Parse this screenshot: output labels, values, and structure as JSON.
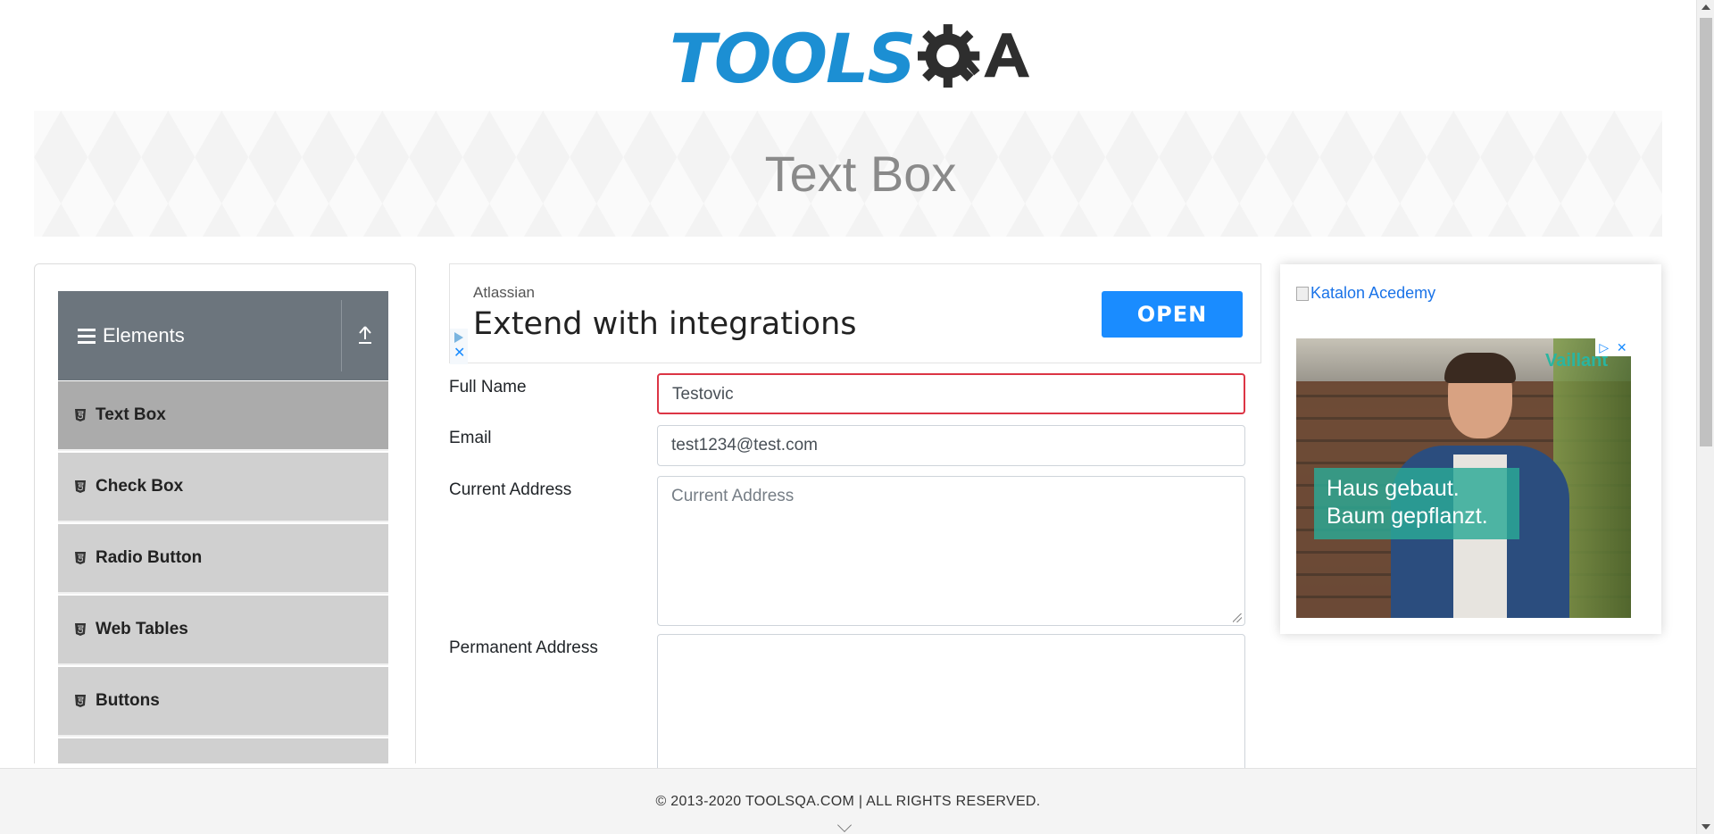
{
  "header": {
    "logo_text": "TOOLSQA"
  },
  "banner": {
    "title": "Text Box"
  },
  "sidebar": {
    "group_title": "Elements",
    "items": [
      {
        "label": "Text Box",
        "active": true
      },
      {
        "label": "Check Box",
        "active": false
      },
      {
        "label": "Radio Button",
        "active": false
      },
      {
        "label": "Web Tables",
        "active": false
      },
      {
        "label": "Buttons",
        "active": false
      }
    ]
  },
  "ad_top": {
    "advertiser": "Atlassian",
    "headline": "Extend with integrations",
    "cta": "OPEN"
  },
  "form": {
    "full_name": {
      "label": "Full Name",
      "value": "Testovic"
    },
    "email": {
      "label": "Email",
      "value": "test1234@test.com"
    },
    "current_address": {
      "label": "Current Address",
      "placeholder": "Current Address",
      "value": ""
    },
    "permanent_address": {
      "label": "Permanent Address",
      "value": ""
    }
  },
  "right_ad": {
    "link_text": "Katalon Acedemy",
    "caption_line1": "Haus gebaut.",
    "caption_line2": "Baum gepflanzt.",
    "brand": "Vaillant"
  },
  "footer": {
    "copyright": "© 2013-2020 TOOLSQA.COM | ALL RIGHTS RESERVED."
  },
  "colors": {
    "brand_blue": "#1c8fd3",
    "menu_header": "#6c757d",
    "menu_item": "#d0d0d0",
    "menu_item_active": "#ababab",
    "invalid_border": "#dc3545",
    "cta_blue": "#1a8cff"
  }
}
